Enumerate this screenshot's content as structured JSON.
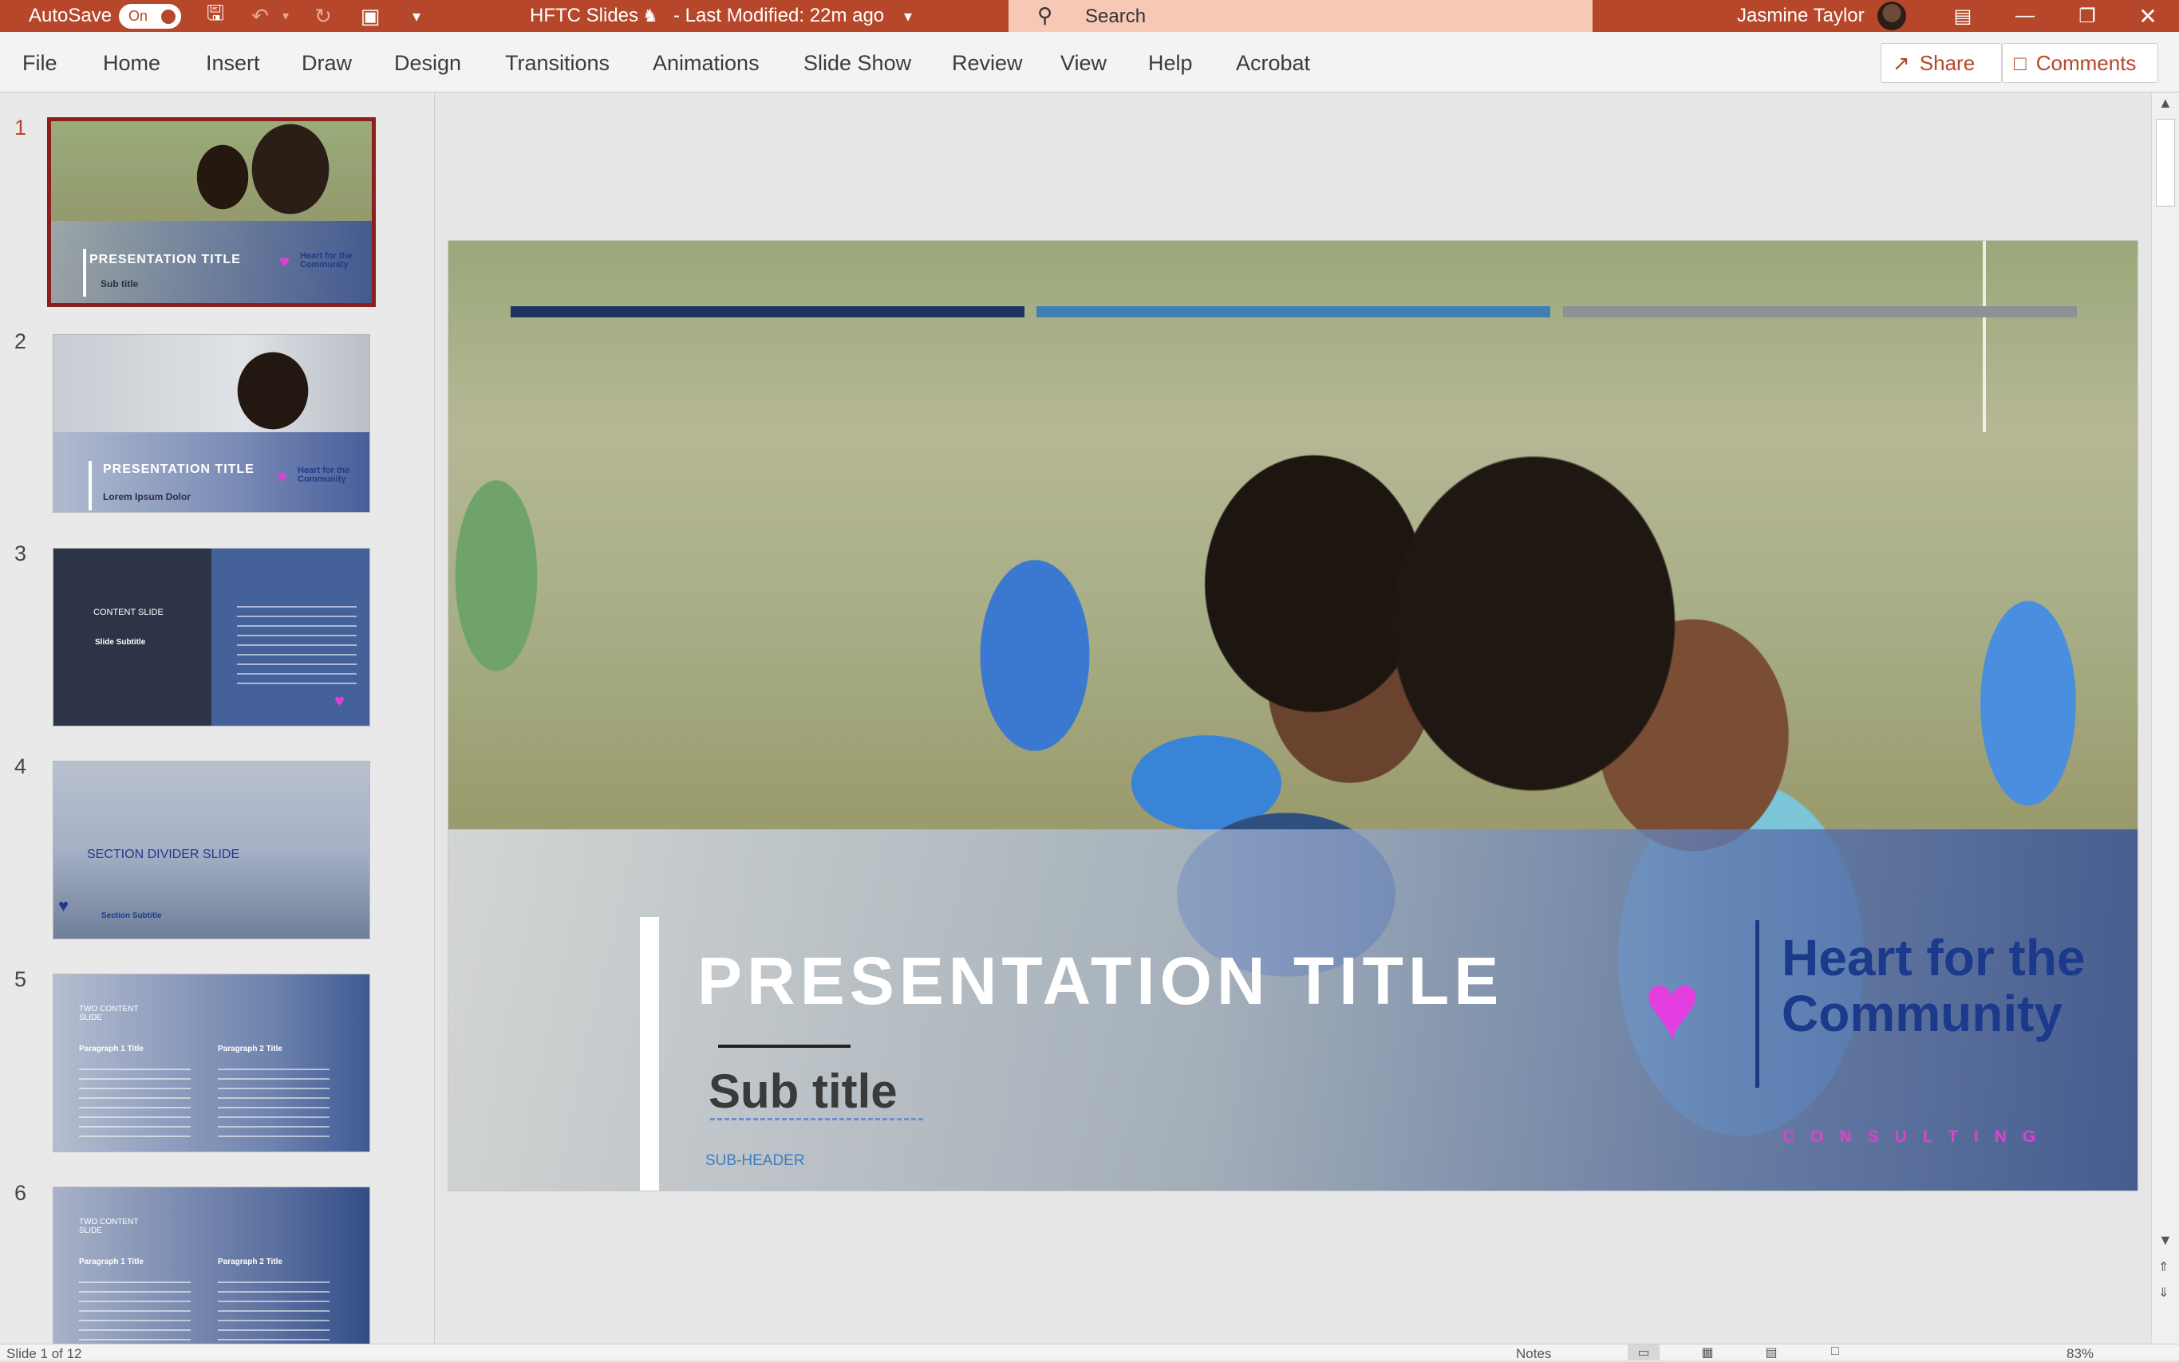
{
  "titlebar": {
    "autosave_label": "AutoSave",
    "autosave_state": "On",
    "doc_title": "HFTC Slides",
    "modified": "- Last Modified: 22m ago",
    "search_placeholder": "Search",
    "user_name": "Jasmine Taylor",
    "colors": {
      "bar": "#b7472a",
      "search": "#f8c8b6"
    }
  },
  "ribbon": {
    "tabs": [
      "File",
      "Home",
      "Insert",
      "Draw",
      "Design",
      "Transitions",
      "Animations",
      "Slide Show",
      "Review",
      "View",
      "Help",
      "Acrobat"
    ],
    "share_label": "Share",
    "comments_label": "Comments"
  },
  "thumbnails": [
    {
      "number": "1",
      "title": "PRESENTATION TITLE",
      "subtitle": "Sub title",
      "logo": "Heart for the Community",
      "active": true
    },
    {
      "number": "2",
      "title": "PRESENTATION TITLE",
      "subtitle": "Lorem Ipsum Dolor",
      "logo": "Heart for the Community"
    },
    {
      "number": "3",
      "title": "CONTENT SLIDE",
      "subtitle": "Slide Subtitle"
    },
    {
      "number": "4",
      "title": "SECTION DIVIDER SLIDE",
      "subtitle": "Section Subtitle"
    },
    {
      "number": "5",
      "title": "TWO CONTENT SLIDE",
      "para1": "Paragraph 1 Title",
      "para2": "Paragraph 2 Title"
    },
    {
      "number": "6",
      "title": "TWO CONTENT SLIDE",
      "para1": "Paragraph 1 Title",
      "para2": "Paragraph 2 Title"
    }
  ],
  "slide": {
    "title": "PRESENTATION TITLE",
    "subtitle": "Sub title",
    "subheader": "SUB-HEADER",
    "logo_text": "Heart for the Community",
    "logo_tagline": "CONSULTING",
    "accent_colors": [
      "#1d3461",
      "#3f7fb3",
      "#8d9096"
    ],
    "brand_colors": {
      "navy": "#1b3a8c",
      "pink": "#e040d0"
    }
  },
  "statusbar": {
    "slide_info": "Slide 1 of 12",
    "notes_label": "Notes",
    "zoom": "83%"
  },
  "icons": [
    "save-icon",
    "undo-icon",
    "redo-icon",
    "present-icon",
    "customize-icon",
    "share-people-icon",
    "search-icon",
    "ribbon-display-icon",
    "minimize-icon",
    "restore-icon",
    "close-icon"
  ]
}
